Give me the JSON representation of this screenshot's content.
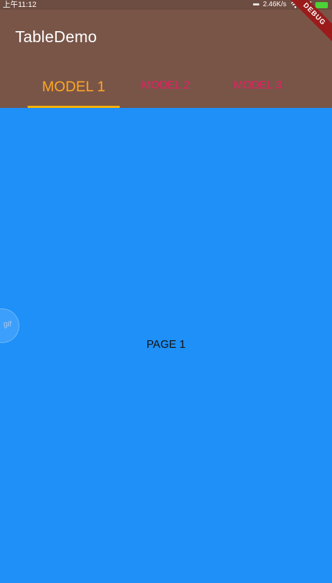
{
  "status_bar": {
    "time": "上午11:12",
    "dots": "•••",
    "speed": "2.46K/s"
  },
  "app_bar": {
    "title": "TableDemo"
  },
  "debug_banner": "DEBUG",
  "tabs": [
    {
      "label": "MODEL 1",
      "active": true
    },
    {
      "label": "MODEL 2",
      "active": false
    },
    {
      "label": "MODEL 3",
      "active": false
    }
  ],
  "page": {
    "label": "PAGE 1"
  },
  "floating_bubble": {
    "label": "gif"
  },
  "colors": {
    "app_bar": "#795548",
    "page_background": "#1e90f7",
    "active_tab": "#ffa726",
    "inactive_tab": "#e91e63",
    "indicator": "#ffb300"
  }
}
